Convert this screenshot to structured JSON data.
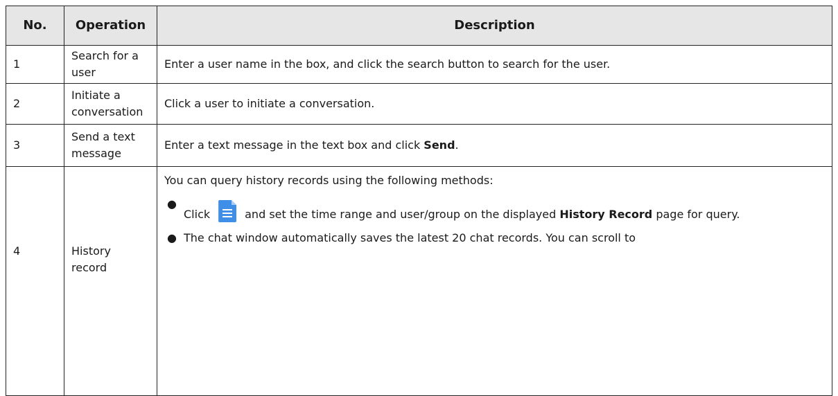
{
  "headers": {
    "no": "No.",
    "operation": "Operation",
    "description": "Description"
  },
  "rows": [
    {
      "no": "1",
      "operation": "Search for a user",
      "description": "Enter a user name in the box, and click the search button to search for the user."
    },
    {
      "no": "2",
      "operation": "Initiate a conversation",
      "description": "Click a user to initiate a conversation."
    },
    {
      "no": "3",
      "operation": "Send a text message",
      "description_pre": "Enter a text message in the text box and click ",
      "description_bold": "Send",
      "description_post": "."
    },
    {
      "no": "4",
      "operation": "History record",
      "intro": "You can query history records using the following methods:",
      "bullet1_pre": "Click",
      "bullet1_icon": "document-icon",
      "bullet1_mid": "and set the time range and user/group on the displayed ",
      "bullet1_bold": "History Record",
      "bullet1_post": " page for query.",
      "bullet2": "The chat window automatically saves the latest 20 chat records. You can scroll to"
    }
  ],
  "colors": {
    "header_bg": "#e6e6e6",
    "border": "#222222",
    "icon_blue": "#3f8fe8"
  }
}
